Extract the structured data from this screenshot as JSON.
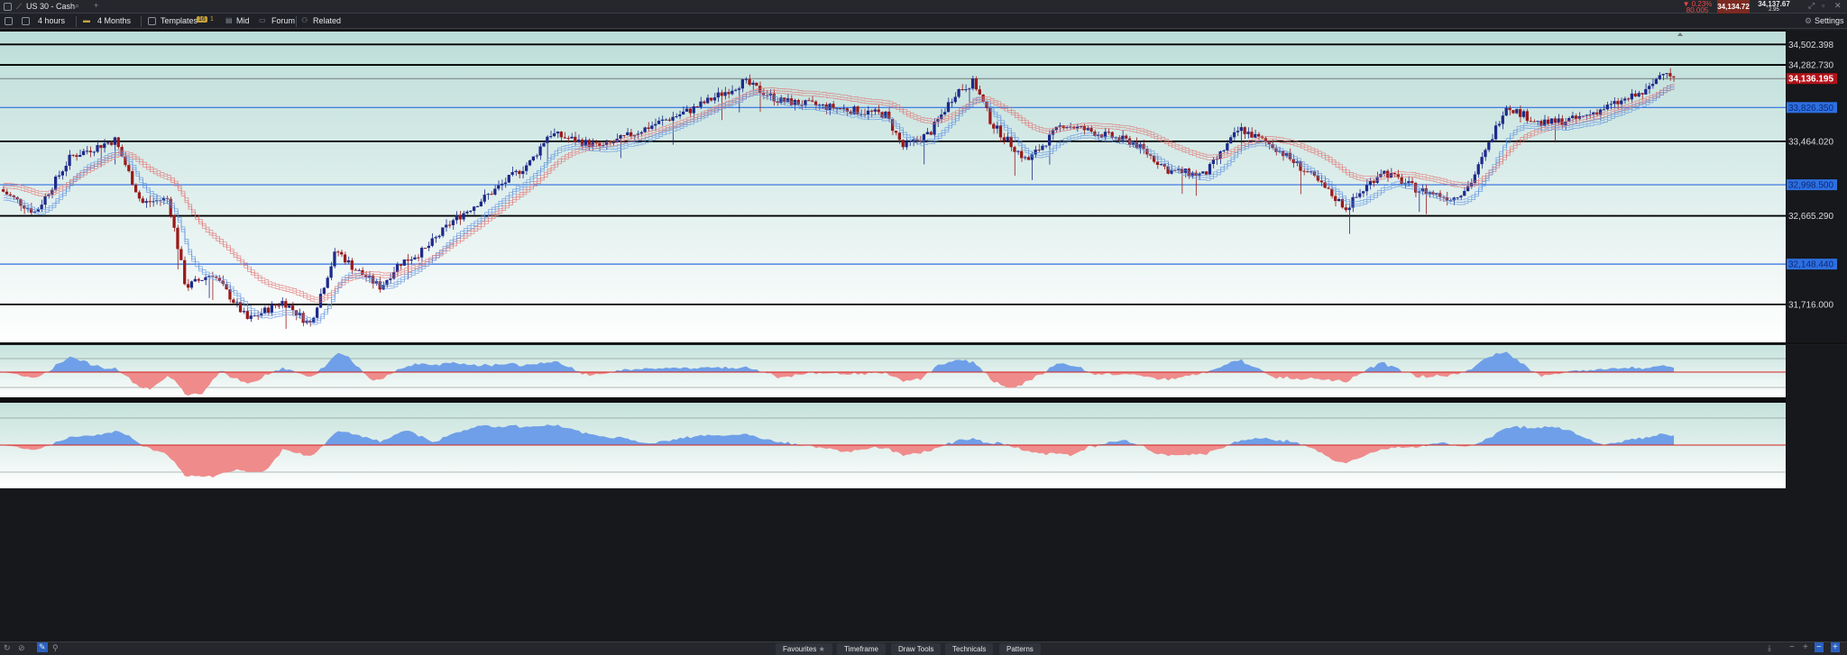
{
  "titlebar": {
    "instrument": "US 30 - Cash",
    "change_pct": "▼ 0.23%",
    "change_pts": "80.005",
    "bid": "34,134.72",
    "ask": "34,137.67",
    "spread": "2.95"
  },
  "toolbar": {
    "period": "4 hours",
    "range": "4 Months",
    "templates": "Templates",
    "badge": "16",
    "badge2": "1",
    "price_mode": "Mid",
    "forum": "Forum",
    "related": "Related",
    "settings": "Settings"
  },
  "axis": {
    "l1": "34,502.398",
    "l2": "34,282.730",
    "current": "34,136.195",
    "b1": "33,826.350",
    "l3": "33,464.020",
    "b2": "32,998.500",
    "l4": "32,665.290",
    "b3": "32,148.440",
    "l5": "31,716.000"
  },
  "bottom": {
    "favourites": "Favourites",
    "timeframe": "Timeframe",
    "draw_tools": "Draw Tools",
    "technicals": "Technicals",
    "patterns": "Patterns"
  },
  "colors": {
    "up": "#1e2a8a",
    "down": "#9a1a1a",
    "blue_line": "#2e6fe0",
    "current_price": "#b3121a",
    "osc_pos": "#6f9fe8",
    "osc_neg": "#ef8b8b"
  },
  "chart_data": {
    "type": "candlestick",
    "timeframe": "4 hours",
    "ylim": [
      31300,
      34650
    ],
    "hlines_black": [
      34502.398,
      34282.73,
      33464.02,
      32665.29,
      31716.0
    ],
    "hlines_blue": [
      33826.35,
      32998.5,
      32148.44
    ],
    "current_price": 34136.195,
    "close_path": [
      [
        0,
        32950
      ],
      [
        0.02,
        32700
      ],
      [
        0.04,
        33300
      ],
      [
        0.065,
        33480
      ],
      [
        0.08,
        32800
      ],
      [
        0.095,
        32850
      ],
      [
        0.105,
        31900
      ],
      [
        0.12,
        32050
      ],
      [
        0.14,
        31550
      ],
      [
        0.16,
        31750
      ],
      [
        0.175,
        31500
      ],
      [
        0.19,
        32300
      ],
      [
        0.2,
        32100
      ],
      [
        0.215,
        31900
      ],
      [
        0.225,
        32150
      ],
      [
        0.24,
        32300
      ],
      [
        0.255,
        32600
      ],
      [
        0.28,
        32950
      ],
      [
        0.3,
        33250
      ],
      [
        0.31,
        33550
      ],
      [
        0.34,
        33400
      ],
      [
        0.37,
        33650
      ],
      [
        0.39,
        33800
      ],
      [
        0.41,
        34000
      ],
      [
        0.42,
        34100
      ],
      [
        0.44,
        33900
      ],
      [
        0.46,
        33850
      ],
      [
        0.48,
        33800
      ],
      [
        0.5,
        33750
      ],
      [
        0.51,
        33400
      ],
      [
        0.525,
        33550
      ],
      [
        0.54,
        34000
      ],
      [
        0.55,
        34100
      ],
      [
        0.56,
        33650
      ],
      [
        0.58,
        33250
      ],
      [
        0.6,
        33650
      ],
      [
        0.62,
        33550
      ],
      [
        0.64,
        33450
      ],
      [
        0.66,
        33150
      ],
      [
        0.68,
        33100
      ],
      [
        0.7,
        33600
      ],
      [
        0.72,
        33400
      ],
      [
        0.74,
        33100
      ],
      [
        0.76,
        32750
      ],
      [
        0.78,
        33150
      ],
      [
        0.8,
        32950
      ],
      [
        0.82,
        32850
      ],
      [
        0.83,
        33000
      ],
      [
        0.84,
        33400
      ],
      [
        0.85,
        33850
      ],
      [
        0.87,
        33650
      ],
      [
        0.89,
        33700
      ],
      [
        0.91,
        33850
      ],
      [
        0.93,
        34000
      ],
      [
        0.94,
        34250
      ],
      [
        0.945,
        34136
      ]
    ]
  }
}
